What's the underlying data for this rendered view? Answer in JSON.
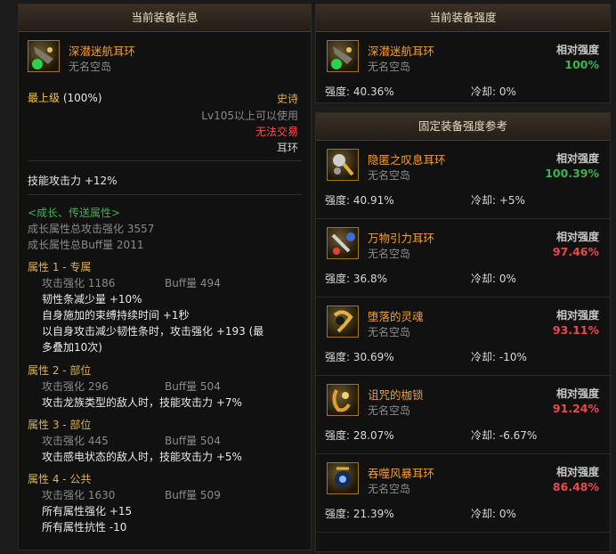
{
  "left": {
    "header": "当前装备信息",
    "item_name": "深潜迷航耳环",
    "item_sub": "无名空岛",
    "grade_label": "最上级",
    "grade_pct": "(100%)",
    "rarity": "史诗",
    "level_req": "Lv105以上可以使用",
    "trade": "无法交易",
    "slot": "耳环",
    "skill_atk": "技能攻击力  +12%",
    "growth_title": "<成长、传送属性>",
    "growth_total": "成长属性总攻击强化 3557",
    "growth_buff": "成长属性总Buff量 2011",
    "attrs": [
      {
        "title": "属性 1 - 专属",
        "atk": "攻击强化  1186",
        "buff": "Buff量  494",
        "lines": [
          "韧性条减少量 +10%",
          "自身施加的束缚持续时间 +1秒",
          "以自身攻击减少韧性条时，攻击强化 +193 (最",
          "多叠加10次)"
        ]
      },
      {
        "title": "属性 2 - 部位",
        "atk": "攻击强化  296",
        "buff": "Buff量  504",
        "lines": [
          "攻击龙族类型的敌人时，技能攻击力 +7%"
        ]
      },
      {
        "title": "属性 3 - 部位",
        "atk": "攻击强化  445",
        "buff": "Buff量  504",
        "lines": [
          "攻击感电状态的敌人时，技能攻击力 +5%"
        ]
      },
      {
        "title": "属性 4 - 公共",
        "atk": "攻击强化  1630",
        "buff": "Buff量  509",
        "lines": [
          "所有属性强化 +15",
          "所有属性抗性 -10"
        ]
      }
    ]
  },
  "current": {
    "header": "当前装备强度",
    "name": "深潜迷航耳环",
    "sub": "无名空岛",
    "rel_label": "相对强度",
    "rel_value": "100%",
    "strength": "强度: 40.36%",
    "cooldown": "冷却: 0%"
  },
  "reference": {
    "header": "固定装备强度参考",
    "items": [
      {
        "name": "隐匿之叹息耳环",
        "sub": "无名空岛",
        "rel_label": "相对强度",
        "rel_value": "100.39%",
        "rel_color": "#39b54a",
        "strength": "强度: 40.91%",
        "cooldown": "冷却: +5%",
        "icon": "earring-icon-sigh"
      },
      {
        "name": "万物引力耳环",
        "sub": "无名空岛",
        "rel_label": "相对强度",
        "rel_value": "97.46%",
        "rel_color": "#e84a4a",
        "strength": "强度: 36.8%",
        "cooldown": "冷却: 0%",
        "icon": "earring-icon-gravity"
      },
      {
        "name": "堕落的灵魂",
        "sub": "无名空岛",
        "rel_label": "相对强度",
        "rel_value": "93.11%",
        "rel_color": "#e84a4a",
        "strength": "强度: 30.69%",
        "cooldown": "冷却: -10%",
        "icon": "earring-icon-soul"
      },
      {
        "name": "诅咒的枷锁",
        "sub": "无名空岛",
        "rel_label": "相对强度",
        "rel_value": "91.24%",
        "rel_color": "#e84a4a",
        "strength": "强度: 28.07%",
        "cooldown": "冷却: -6.67%",
        "icon": "earring-icon-shackle"
      },
      {
        "name": "吞噬风暴耳环",
        "sub": "无名空岛",
        "rel_label": "相对强度",
        "rel_value": "86.48%",
        "rel_color": "#e84a4a",
        "strength": "强度: 21.39%",
        "cooldown": "冷却: 0%",
        "icon": "earring-icon-storm"
      }
    ]
  }
}
